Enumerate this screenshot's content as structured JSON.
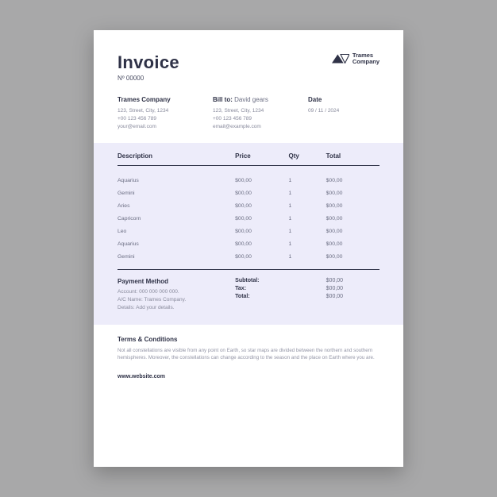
{
  "header": {
    "title": "Invoice",
    "number": "Nº 00000",
    "company_name": "Trames",
    "company_sub": "Company"
  },
  "from": {
    "heading": "Trames Company",
    "line1": "123, Street, City, 1234",
    "line2": "+00 123 456 789",
    "line3": "your@email.com"
  },
  "billto": {
    "heading": "Bill to:",
    "name": "David gears",
    "line1": "123, Street, City, 1234",
    "line2": "+00 123 456 789",
    "line3": "email@example.com"
  },
  "date": {
    "heading": "Date",
    "value": "09 / 11 / 2024"
  },
  "table": {
    "headers": {
      "desc": "Description",
      "price": "Price",
      "qty": "Qty",
      "total": "Total"
    },
    "rows": [
      {
        "desc": "Aquarius",
        "price": "$00,00",
        "qty": "1",
        "total": "$00,00"
      },
      {
        "desc": "Gemini",
        "price": "$00,00",
        "qty": "1",
        "total": "$00,00"
      },
      {
        "desc": "Aries",
        "price": "$00,00",
        "qty": "1",
        "total": "$00,00"
      },
      {
        "desc": "Capricorn",
        "price": "$00,00",
        "qty": "1",
        "total": "$00,00"
      },
      {
        "desc": "Leo",
        "price": "$00,00",
        "qty": "1",
        "total": "$00,00"
      },
      {
        "desc": "Aquarius",
        "price": "$00,00",
        "qty": "1",
        "total": "$00,00"
      },
      {
        "desc": "Gemini",
        "price": "$00,00",
        "qty": "1",
        "total": "$00,00"
      }
    ]
  },
  "payment": {
    "heading": "Payment Method",
    "line1": "Account: 000 000 000 000.",
    "line2": "A/C Name: Trames Company.",
    "line3": "Details: Add your details."
  },
  "summary": {
    "subtotal_label": "Subtotal:",
    "subtotal_value": "$00,00",
    "tax_label": "Tax:",
    "tax_value": "$00,00",
    "total_label": "Total:",
    "total_value": "$00,00"
  },
  "terms": {
    "heading": "Terms & Conditions",
    "body": "Not all constellations are visible from any point on Earth, so star maps are divided between the northern and southern hemispheres. Moreover, the constellations can change according to the season and the place on Earth where you are."
  },
  "footer": {
    "website": "www.website.com"
  }
}
